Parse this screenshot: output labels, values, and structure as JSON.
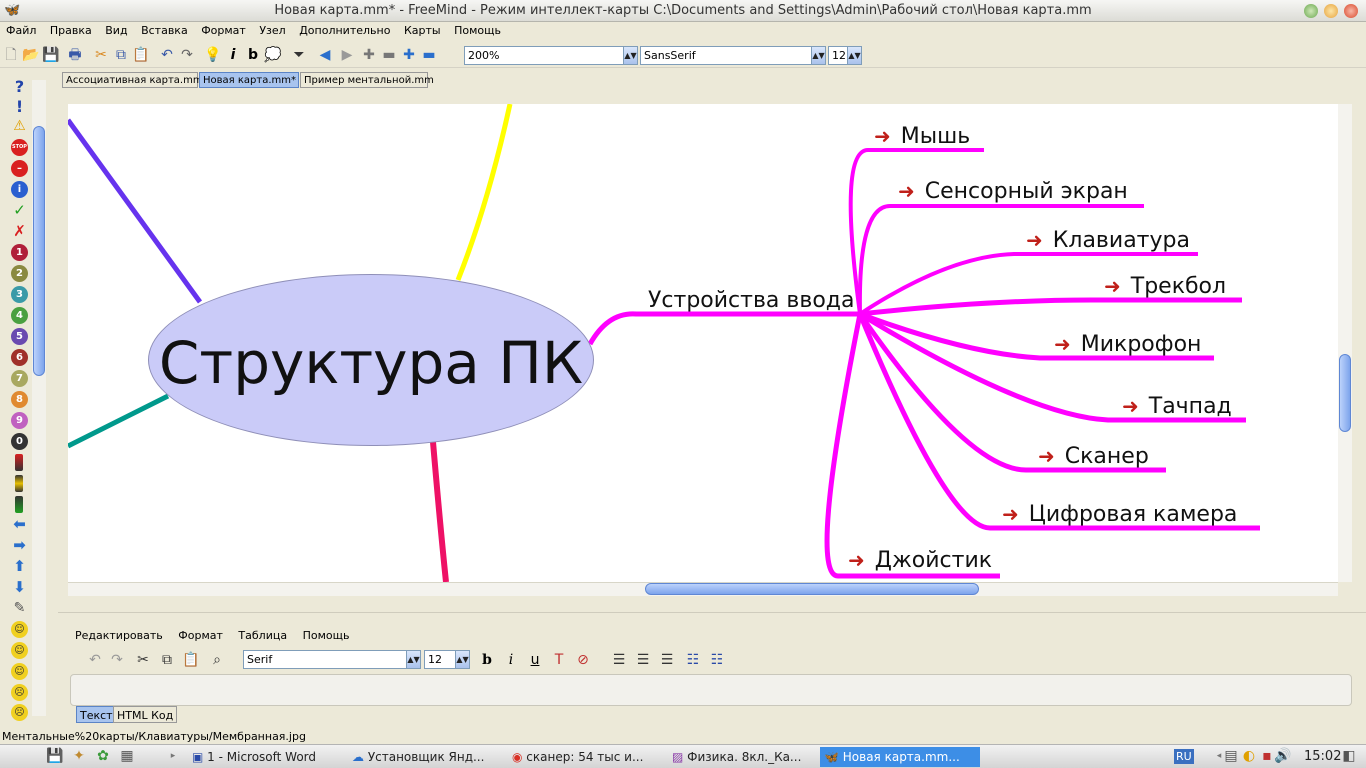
{
  "window": {
    "title": "Новая карта.mm* - FreeMind - Режим интеллект-карты C:\\Documents and Settings\\Admin\\Рабочий стол\\Новая карта.mm"
  },
  "menu": [
    "Файл",
    "Правка",
    "Вид",
    "Вставка",
    "Формат",
    "Узел",
    "Дополнительно",
    "Карты",
    "Помощь"
  ],
  "toolbar": {
    "zoom": "200%",
    "font": "SansSerif",
    "font_size": "12"
  },
  "tabs": [
    "Ассоциативная карта.mm",
    "Новая карта.mm*",
    "Пример ментальной.mm"
  ],
  "left_icons": [
    "?",
    "!",
    "⚠",
    "STOP",
    "–",
    "i",
    "✓",
    "✗",
    "1",
    "2",
    "3",
    "4",
    "5",
    "6",
    "7",
    "8",
    "9",
    "0"
  ],
  "map": {
    "root": "Структура ПК",
    "branch": "Устройства ввода",
    "children": [
      "Мышь",
      "Сенсорный экран",
      "Клавиатура",
      "Трекбол",
      "Микрофон",
      "Тачпад",
      "Сканер",
      "Цифровая камера",
      "Джойстик"
    ],
    "colors": {
      "root_fill": "#cacbf8",
      "branch_edge": "#ff00ff",
      "purple_edge": "#6633ee",
      "yellow_edge": "#ffff00",
      "teal_edge": "#00998c",
      "red_edge": "#ee1166",
      "arrow_icon": "#c0201a"
    }
  },
  "notes": {
    "menu": [
      "Редактировать",
      "Формат",
      "Таблица",
      "Помощь"
    ],
    "font": "Serif",
    "font_size": "12",
    "tabs": [
      "Текст",
      "HTML Код"
    ]
  },
  "status": "Ментальные%20карты/Клавиатуры/Мембранная.jpg",
  "taskbar": {
    "tasks": [
      "1 - Microsoft Word",
      "Установщик Янд...",
      "сканер: 54 тыс и...",
      "Физика. 8кл._Ка...",
      "Новая карта.mm..."
    ],
    "lang": "RU",
    "time": "15:02"
  }
}
